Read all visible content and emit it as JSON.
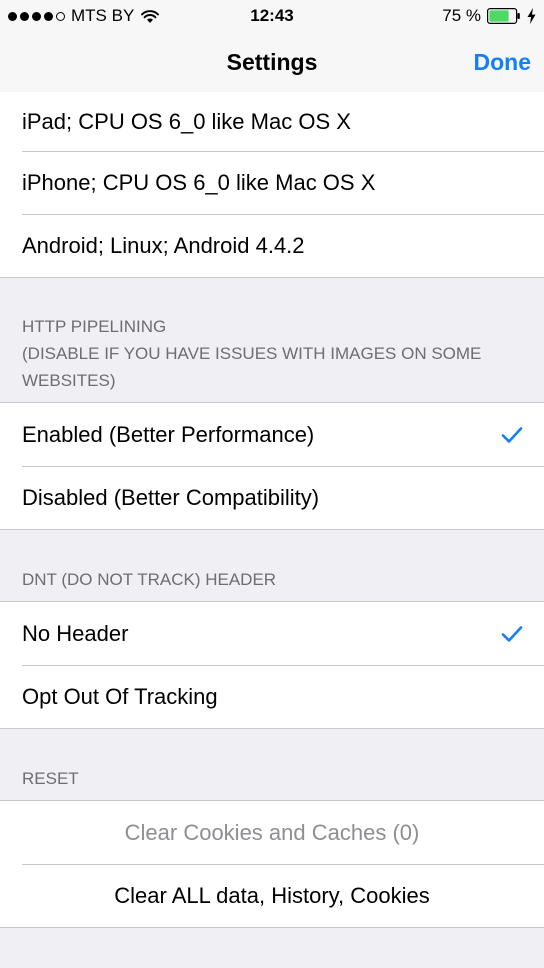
{
  "status_bar": {
    "carrier": "MTS BY",
    "time": "12:43",
    "battery_percent": "75 %",
    "signal_bars_filled": 4,
    "signal_bars_total": 5,
    "battery_level": 0.75,
    "charging": true
  },
  "nav": {
    "title": "Settings",
    "done_label": "Done"
  },
  "user_agent_rows": [
    "iPad; CPU OS 6_0 like Mac OS X",
    "iPhone; CPU OS 6_0 like Mac OS X",
    "Android; Linux; Android 4.4.2"
  ],
  "http_pipelining": {
    "header_line1": "HTTP PIPELINING",
    "header_line2": "(DISABLE IF YOU HAVE ISSUES WITH IMAGES ON SOME WEBSITES)",
    "options": [
      {
        "label": "Enabled (Better Performance)",
        "selected": true
      },
      {
        "label": "Disabled (Better Compatibility)",
        "selected": false
      }
    ]
  },
  "dnt": {
    "header": "DNT (DO NOT TRACK) HEADER",
    "options": [
      {
        "label": "No Header",
        "selected": true
      },
      {
        "label": "Opt Out Of Tracking",
        "selected": false
      }
    ]
  },
  "reset": {
    "header": "RESET",
    "clear_cookies_label": "Clear Cookies and Caches (0)",
    "clear_all_label": "Clear ALL data, History, Cookies"
  },
  "colors": {
    "accent": "#147efb",
    "background": "#efeff4",
    "separator": "#c8c7cc",
    "section_header": "#6d6d72",
    "disabled_text": "#8e8e93",
    "battery_fill": "#4cd964"
  }
}
